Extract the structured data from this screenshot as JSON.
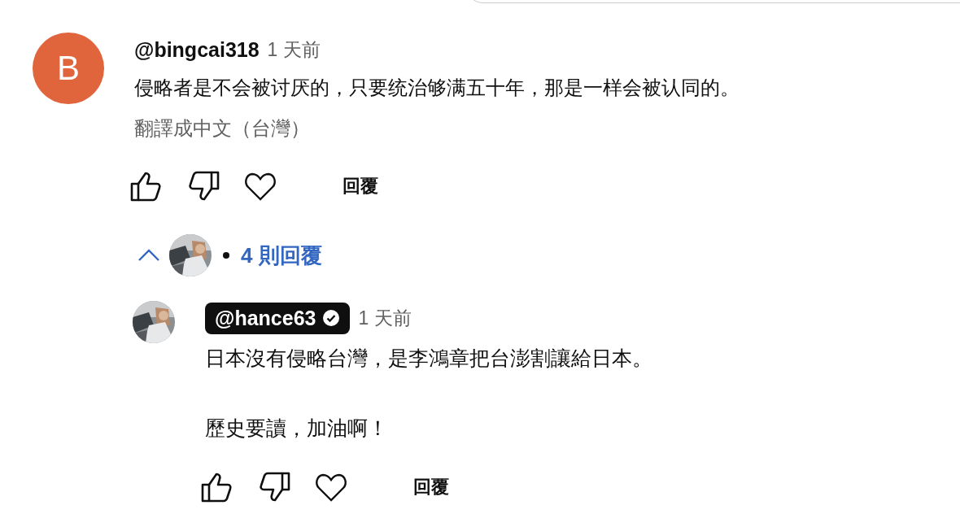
{
  "comments": [
    {
      "avatar": {
        "kind": "letter",
        "letter": "B"
      },
      "author": "@bingcai318",
      "owner": false,
      "time": "1 天前",
      "paragraphs": [
        "侵略者是不会被讨厌的，只要统治够满五十年，那是一样会被认同的。"
      ],
      "translate": "翻譯成中文（台灣）",
      "reply_label": "回覆"
    }
  ],
  "replies_toggle": {
    "expanded": true,
    "label": "4 則回覆"
  },
  "replies": [
    {
      "author": "@hance63",
      "owner": true,
      "verified": true,
      "time": "1 天前",
      "paragraphs": [
        "日本沒有侵略台灣，是李鴻章把台澎割讓給日本。",
        "歷史要讀，加油啊！"
      ],
      "reply_label": "回覆"
    }
  ]
}
